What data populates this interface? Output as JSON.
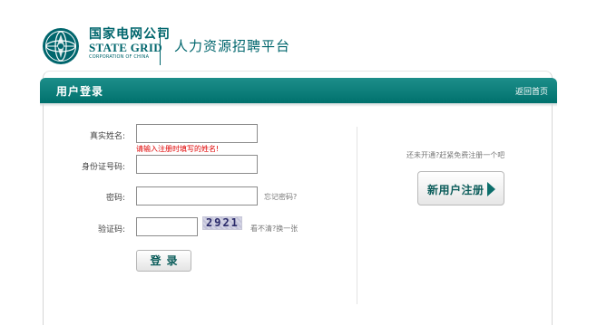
{
  "brand": {
    "name_cn": "国家电网公司",
    "name_en": "STATE GRID",
    "name_sub": "CORPORATION OF CHINA",
    "portal_title": "人力资源招聘平台"
  },
  "panel": {
    "title": "用户登录",
    "home_link": "返回首页"
  },
  "form": {
    "name_label": "真实姓名:",
    "name_value": "",
    "name_hint": "请输入注册时填写的姓名!",
    "id_label": "身份证号码:",
    "id_value": "",
    "password_label": "密码:",
    "password_value": "",
    "forgot_link": "忘记密码?",
    "captcha_label": "验证码:",
    "captcha_value": "",
    "captcha_text": "2921",
    "refresh_link": "看不清?换一张",
    "login_button": "登录"
  },
  "register": {
    "prompt": "还未开通?赶紧免费注册一个吧",
    "button": "新用户注册"
  },
  "colors": {
    "brand": "#00666d",
    "bar_top": "#1d8e8a",
    "bar_bottom": "#00716d",
    "error": "#e00000"
  }
}
